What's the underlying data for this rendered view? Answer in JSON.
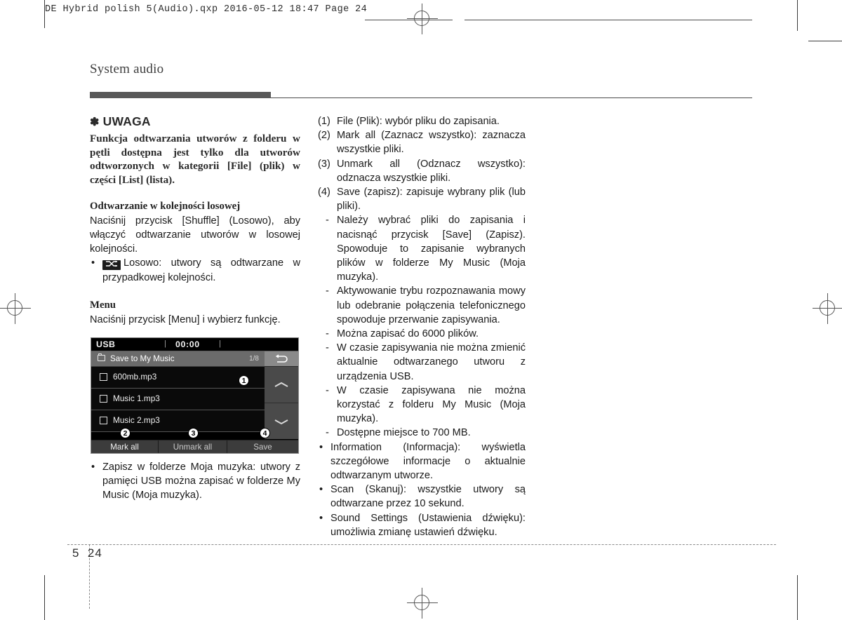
{
  "print_slug": "DE Hybrid polish 5(Audio).qxp   2016-05-12   18:47   Page 24",
  "section": {
    "title": "System audio"
  },
  "left_column": {
    "note": {
      "asterisk": "✽",
      "heading": "UWAGA",
      "body": "Funkcja odtwarzania utworów z folderu w pętli dostępna jest tylko dla utworów odtworzonych w kategorii [File] (plik) w części [List] (lista)."
    },
    "shuffle_section": {
      "heading": "Odtwarzanie w kolejności losowej",
      "paragraph": "Naciśnij przycisk [Shuffle] (Losowo), aby włączyć odtwarzanie utworów w losowej kolejności.",
      "bullet_icon": "shuffle-icon",
      "bullet_icon_glyph": "⤬",
      "bullet_text": "Losowo: utwory są odtwarzane w przypadkowej kolejności."
    },
    "menu_section": {
      "heading": "Menu",
      "paragraph": "Naciśnij przycisk [Menu] i wybierz funkcję."
    },
    "device_screen": {
      "source": "USB",
      "separator_1": "|",
      "time": "00:00",
      "separator_2": "|",
      "folder_icon": "folder-icon",
      "list_title": "Save to My Music",
      "list_counter": "1/8",
      "back_icon": "back-arrow-icon",
      "scroll_up_icon": "chevron-up-icon",
      "scroll_down_icon": "chevron-down-icon",
      "rows": [
        {
          "name": "600mb.mp3",
          "checkbox": "unchecked"
        },
        {
          "name": "Music 1.mp3",
          "checkbox": "unchecked"
        },
        {
          "name": "Music 2.mp3",
          "checkbox": "unchecked"
        }
      ],
      "buttons": [
        {
          "label": "Mark all"
        },
        {
          "label": "Unmark all"
        },
        {
          "label": "Save"
        }
      ],
      "callouts": [
        {
          "number": "❶"
        },
        {
          "number": "❷"
        },
        {
          "number": "❸"
        },
        {
          "number": "❹"
        }
      ]
    },
    "closing_bullet": "Zapisz w folderze Moja muzyka: utwory z pamięci USB można zapisać w folderze My Music (Moja muzyka)."
  },
  "right_column": {
    "numbered_items": [
      {
        "num": "(1)",
        "text": "File (Plik): wybór pliku do zapisania."
      },
      {
        "num": "(2)",
        "text": "Mark all (Zaznacz wszystko): zaznacza wszystkie pliki."
      },
      {
        "num": "(3)",
        "text": "Unmark all (Odznacz wszystko): odznacza wszystkie pliki."
      },
      {
        "num": "(4)",
        "text": "Save (zapisz): zapisuje wybrany plik (lub pliki)."
      }
    ],
    "dash_items": [
      "Należy wybrać pliki do zapisania i nacisnąć przycisk [Save] (Zapisz). Spowoduje to zapisanie wybranych plików w folderze My Music (Moja muzyka).",
      "Aktywowanie trybu rozpoznawania mowy lub odebranie połączenia telefonicznego spowoduje przerwanie zapisywania.",
      "Można zapisać do 6000 plików.",
      "W czasie zapisywania nie można zmienić aktualnie odtwarzanego utworu z urządzenia USB.",
      "W czasie zapisywana nie można korzystać z folderu My Music (Moja muzyka).",
      "Dostępne miejsce to 700 MB."
    ],
    "bullet_items": [
      "Information (Informacja): wyświetla szczegółowe informacje o aktualnie odtwarzanym utworze.",
      "Scan (Skanuj): wszystkie utwory są odtwarzane przez 10 sekund.",
      "Sound Settings (Ustawienia dźwięku): umożliwia zmianę ustawień dźwięku."
    ]
  },
  "footer": {
    "chapter": "5",
    "page": "24"
  }
}
